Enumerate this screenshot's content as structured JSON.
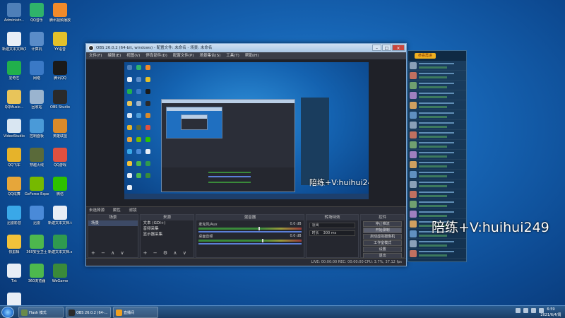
{
  "desktop_icons": [
    {
      "label": "Administr...",
      "color": "#4e7fb8"
    },
    {
      "label": "QQ音乐",
      "color": "#2fb36a"
    },
    {
      "label": "腾讯视频播放",
      "color": "#f08a2a"
    },
    {
      "label": "新建文本文档(1).txt",
      "color": "#e8eef6"
    },
    {
      "label": "计算机",
      "color": "#5a8cc8"
    },
    {
      "label": "YY语音",
      "color": "#e3c12a"
    },
    {
      "label": "爱奇艺",
      "color": "#21b04c"
    },
    {
      "label": "网络",
      "color": "#3a79c6"
    },
    {
      "label": "腾讯QQ",
      "color": "#1a1a1a"
    },
    {
      "label": "QQMusic...",
      "color": "#e8c45a"
    },
    {
      "label": "回收站",
      "color": "#9ab4cf"
    },
    {
      "label": "OBS Studio",
      "color": "#2a2a2a"
    },
    {
      "label": "VideoStudio",
      "color": "#d9e6f2"
    },
    {
      "label": "控制面板",
      "color": "#4a9ad8"
    },
    {
      "label": "英雄联盟",
      "color": "#d98a2a"
    },
    {
      "label": "QQ飞车",
      "color": "#e6b32a"
    },
    {
      "label": "穿越火线",
      "color": "#5a6a3a"
    },
    {
      "label": "QQ游戏",
      "color": "#e05040"
    },
    {
      "label": "QQ炫舞",
      "color": "#e6a63a"
    },
    {
      "label": "GeForce Experience",
      "color": "#76b900"
    },
    {
      "label": "微信",
      "color": "#2dc100"
    },
    {
      "label": "迅雷影音",
      "color": "#3aa8e8"
    },
    {
      "label": "迅雷",
      "color": "#4a8ad8"
    },
    {
      "label": "新建文本文档.txt",
      "color": "#e8eef6"
    },
    {
      "label": "快剪辑",
      "color": "#f2c23a"
    },
    {
      "label": "360安全卫士",
      "color": "#4db84d"
    },
    {
      "label": "新建文本文档.xls",
      "color": "#2f9a4f"
    },
    {
      "label": "Txt",
      "color": "#e8eef6"
    },
    {
      "label": "360浏览器",
      "color": "#4db84d"
    },
    {
      "label": "WeGame",
      "color": "#3a8a3a"
    },
    {
      "label": "新建文本文档",
      "color": "#e8eef6"
    }
  ],
  "obs": {
    "title": "OBS 26.0.2 (64-bit, windows) - 配置文件: 未命名 - 场景: 未命名",
    "menu": [
      "文件(F)",
      "编辑(E)",
      "视图(V)",
      "停靠部件(D)",
      "配置文件(P)",
      "场景集合(S)",
      "工具(T)",
      "帮助(H)"
    ],
    "window_buttons": {
      "min": "–",
      "max": "□",
      "close": "×"
    },
    "status_row": [
      "未选择源",
      "属性",
      "滤镜"
    ],
    "docks": {
      "scenes": {
        "header": "场景",
        "items": [
          "场景"
        ],
        "controls": "+ − ∧ ∨"
      },
      "sources": {
        "header": "来源",
        "items": [
          "文本 (GDI+)",
          "音频采集",
          "显示器采集"
        ],
        "controls": "+ − ⚙ ∧ ∨"
      },
      "mixer": {
        "header": "混音器",
        "channels": [
          {
            "name": "麦克风/Aux",
            "db": "0.0 dB",
            "level": 0.58
          },
          {
            "name": "桌面音频",
            "db": "0.0 dB",
            "level": 0.62
          }
        ]
      },
      "transitions": {
        "header": "转场特效",
        "type": "淡出",
        "duration_label": "时长",
        "duration": "300 ms"
      },
      "controls": {
        "header": "控件",
        "buttons": [
          "停止推流",
          "开始录制",
          "启动虚拟摄像机",
          "工作室模式",
          "设置",
          "退出"
        ],
        "highlighted": 1
      }
    },
    "bottom_bar": "LIVE: 00:00:00   REC: 00:00:00   CPU: 3.7%, 37.12 fps",
    "overlay_text_small": "陪练+V:huihui249"
  },
  "qq_panel": {
    "badge": "恭喜再进",
    "rows": 20
  },
  "overlay_text_big": "陪练+V:huihui249",
  "taskbar": {
    "tasks": [
      {
        "label": "Flash 模式",
        "color": "#6a8a4a"
      },
      {
        "label": "OBS 26.0.2 (64-...",
        "color": "#2a2a2a"
      },
      {
        "label": "直播间",
        "color": "#f0a020"
      }
    ],
    "clock_time": "6:59",
    "clock_date": "2021/6/4/周六"
  }
}
